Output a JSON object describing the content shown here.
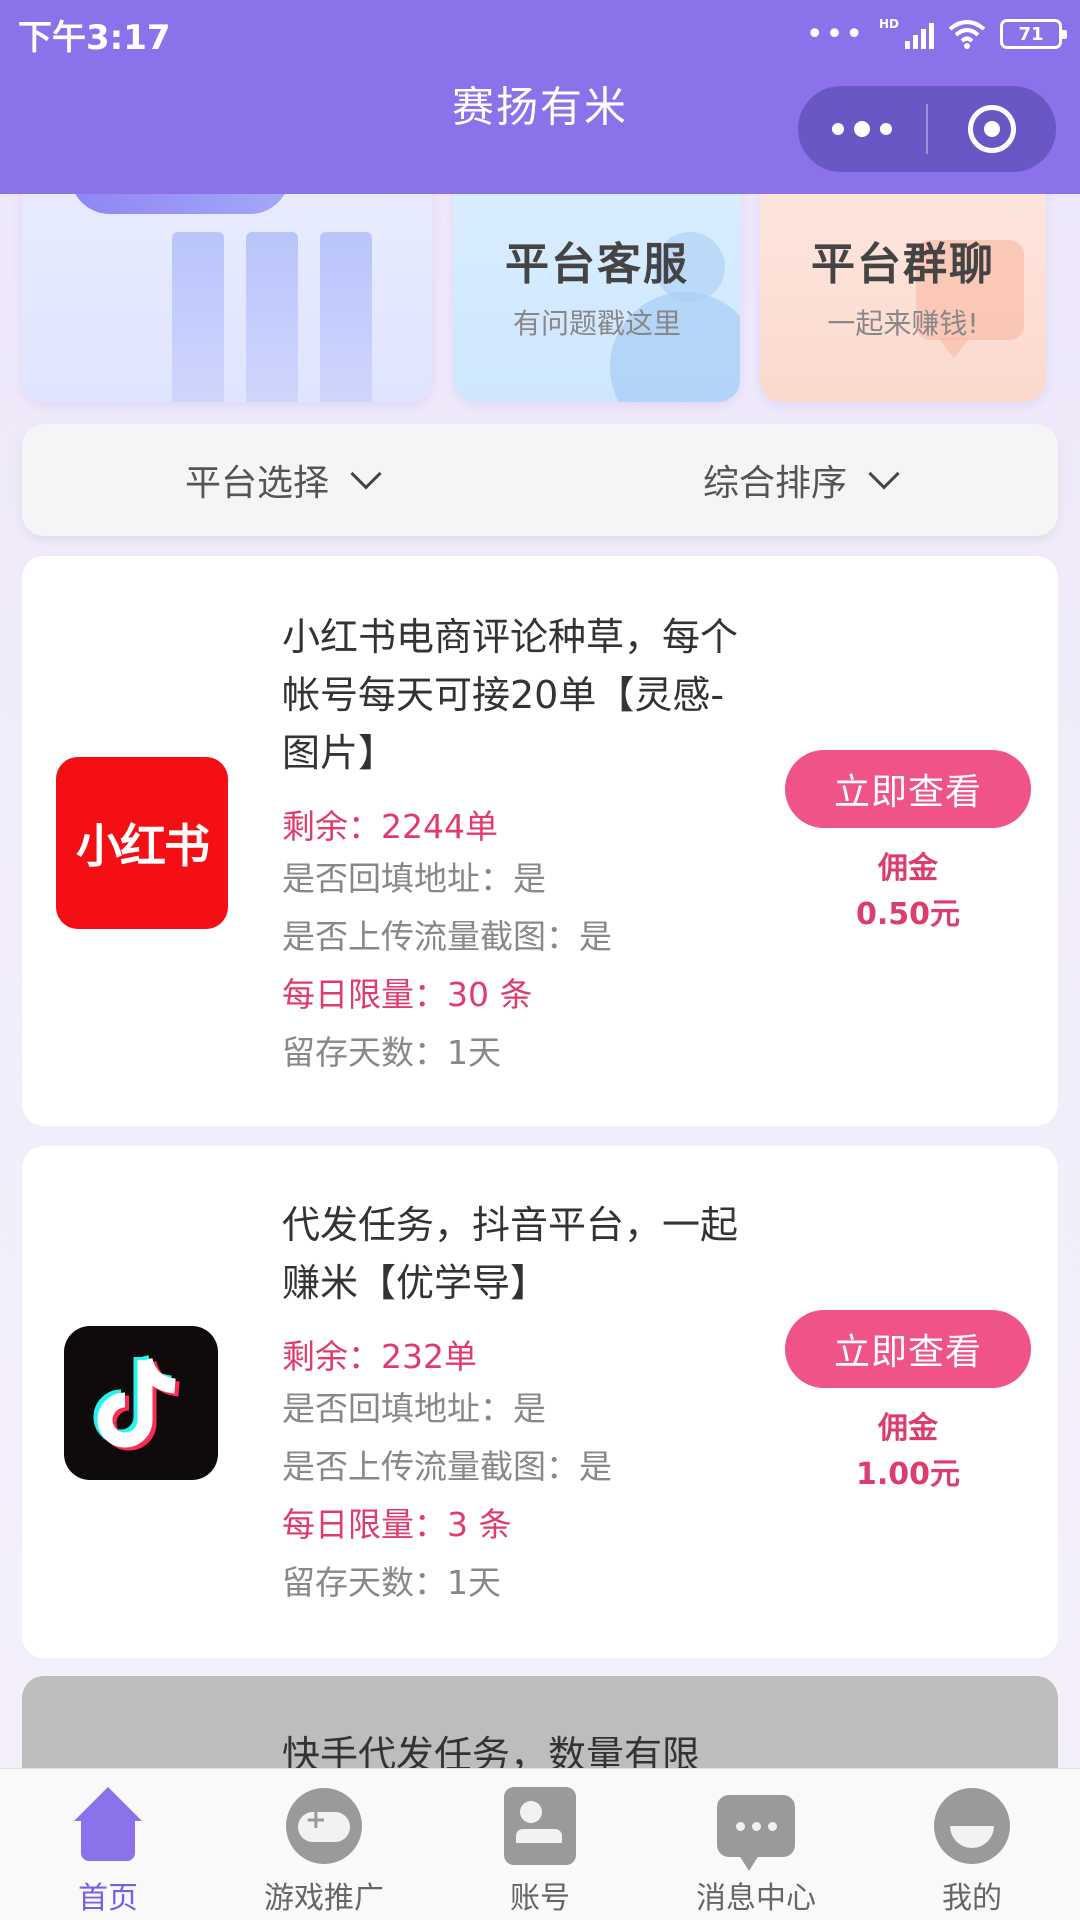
{
  "status_bar": {
    "time": "下午3:17",
    "battery": "71",
    "hd": "HD"
  },
  "header": {
    "title": "赛扬有米"
  },
  "shortcuts": [
    {
      "title": "平台客服",
      "subtitle": "有问题戳这里"
    },
    {
      "title": "平台群聊",
      "subtitle": "一起来赚钱!"
    }
  ],
  "filters": {
    "platform": "平台选择",
    "sort": "综合排序"
  },
  "tasks": [
    {
      "logo_text": "小红书",
      "title": "小红书电商评论种草，每个帐号每天可接20单【灵感-图片】",
      "remaining": "剩余：2244单",
      "fill_address": "是否回填地址：是",
      "upload_screenshot": "是否上传流量截图：是",
      "daily_limit": "每日限量：30 条",
      "retention": "留存天数：1天",
      "button": "立即查看",
      "commission_label": "佣金",
      "commission_value": "0.50元"
    },
    {
      "logo_text": "",
      "title": "代发任务，抖音平台，一起赚米【优学导】",
      "remaining": "剩余：232单",
      "fill_address": "是否回填地址：是",
      "upload_screenshot": "是否上传流量截图：是",
      "daily_limit": "每日限量：3 条",
      "retention": "留存天数：1天",
      "button": "立即查看",
      "commission_label": "佣金",
      "commission_value": "1.00元"
    },
    {
      "title": "快手代发任务，数量有限"
    }
  ],
  "tabbar": [
    {
      "label": "首页",
      "icon": "home-icon",
      "active": true
    },
    {
      "label": "游戏推广",
      "icon": "gamepad-icon"
    },
    {
      "label": "账号",
      "icon": "account-card-icon"
    },
    {
      "label": "消息中心",
      "icon": "message-icon"
    },
    {
      "label": "我的",
      "icon": "profile-icon"
    }
  ],
  "colors": {
    "brand": "#8b72ea",
    "accent": "#f0538a",
    "red_text": "#e23a6c"
  }
}
